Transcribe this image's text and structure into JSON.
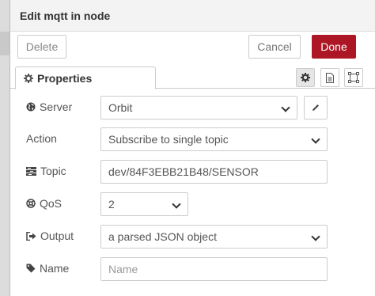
{
  "dialog": {
    "title": "Edit mqtt in node"
  },
  "toolbar": {
    "delete_label": "Delete",
    "cancel_label": "Cancel",
    "done_label": "Done",
    "done_color": "#ad1625"
  },
  "tabs": {
    "properties_label": "Properties",
    "icons": [
      "gear-icon",
      "description-icon",
      "appearance-icon"
    ]
  },
  "form": {
    "server": {
      "label": "Server",
      "value": "Orbit",
      "icon": "globe-icon"
    },
    "action": {
      "label": "Action",
      "value": "Subscribe to single topic"
    },
    "topic": {
      "label": "Topic",
      "value": "dev/84F3EBB21B48/SENSOR",
      "icon": "tasks-icon"
    },
    "qos": {
      "label": "QoS",
      "value": "2",
      "icon": "life-ring-icon"
    },
    "output": {
      "label": "Output",
      "value": "a parsed JSON object",
      "icon": "sign-out-icon"
    },
    "name": {
      "label": "Name",
      "placeholder": "Name",
      "icon": "tag-icon"
    }
  }
}
